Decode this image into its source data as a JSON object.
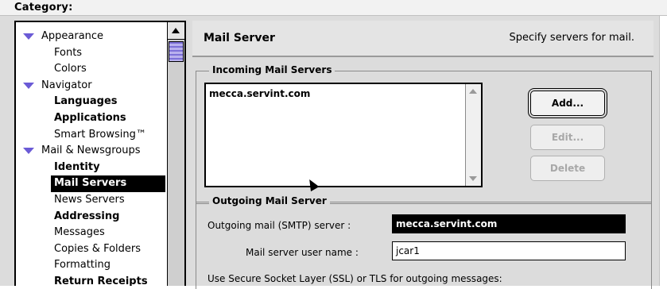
{
  "category": {
    "label": "Category:"
  },
  "tree": {
    "items": [
      {
        "label": "Appearance"
      },
      {
        "label": "Fonts"
      },
      {
        "label": "Colors"
      },
      {
        "label": "Navigator"
      },
      {
        "label": "Languages"
      },
      {
        "label": "Applications"
      },
      {
        "label": "Smart Browsing™"
      },
      {
        "label": "Mail & Newsgroups"
      },
      {
        "label": "Identity"
      },
      {
        "label": "Mail Servers"
      },
      {
        "label": "News Servers"
      },
      {
        "label": "Addressing"
      },
      {
        "label": "Messages"
      },
      {
        "label": "Copies & Folders"
      },
      {
        "label": "Formatting"
      },
      {
        "label": "Return Receipts"
      }
    ]
  },
  "panel": {
    "title": "Mail Server",
    "subtitle": "Specify servers for mail."
  },
  "incoming": {
    "label": "Incoming Mail Servers",
    "servers": [
      "mecca.servint.com"
    ],
    "add_label": "Add...",
    "edit_label": "Edit...",
    "delete_label": "Delete"
  },
  "outgoing": {
    "label": "Outgoing Mail Server",
    "smtp_label": "Outgoing mail (SMTP) server :",
    "smtp_value": "mecca.servint.com",
    "user_label": "Mail server user name :",
    "user_value": "jcar1",
    "ssl_label": "Use Secure Socket Layer (SSL) or TLS for outgoing messages:"
  },
  "colors": {
    "disclosure": "#6b5bd6",
    "scroll_thumb": "#b8b0ee",
    "selection": "#000000"
  },
  "icons": {
    "disclosure": "disclosure-triangle-icon",
    "scroll_up": "scroll-up-arrow-icon",
    "cursor": "mouse-pointer-icon"
  }
}
